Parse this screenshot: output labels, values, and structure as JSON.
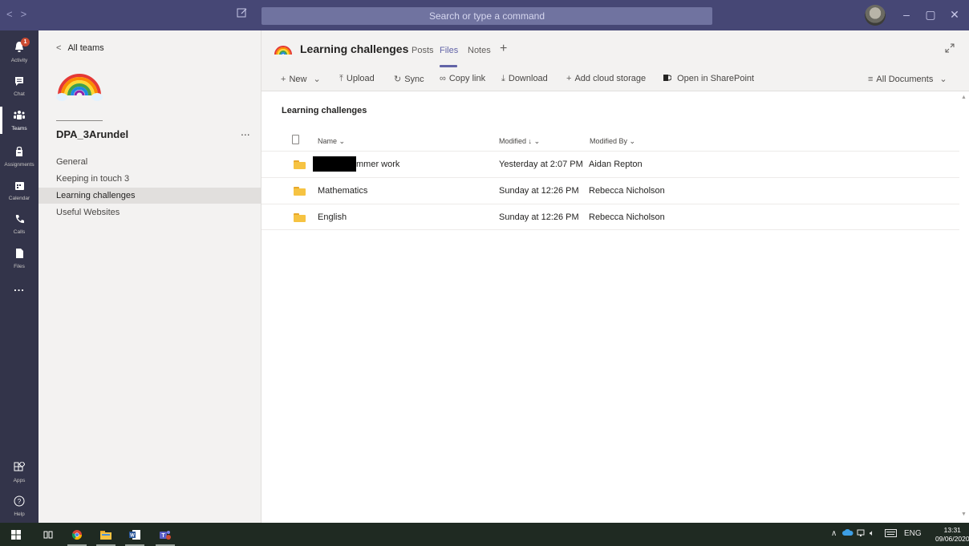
{
  "titlebar": {
    "search_placeholder": "Search or type a command",
    "back_glyph": "<",
    "forward_glyph": ">",
    "minimize_glyph": "–",
    "maximize_glyph": "▢",
    "close_glyph": "✕"
  },
  "rail": {
    "activity": {
      "label": "Activity",
      "badge": "1"
    },
    "chat": {
      "label": "Chat"
    },
    "teams": {
      "label": "Teams"
    },
    "assignments": {
      "label": "Assignments"
    },
    "calendar": {
      "label": "Calendar"
    },
    "calls": {
      "label": "Calls"
    },
    "files": {
      "label": "Files"
    },
    "more": {
      "label": "..."
    },
    "apps": {
      "label": "Apps"
    },
    "help": {
      "label": "Help"
    }
  },
  "teams_panel": {
    "all_teams": "All teams",
    "team_name": "DPA_3Arundel",
    "more_options": "...",
    "channels": [
      {
        "label": "General"
      },
      {
        "label": "Keeping in touch 3"
      },
      {
        "label": "Learning challenges"
      },
      {
        "label": "Useful Websites"
      }
    ]
  },
  "header": {
    "title": "Learning challenges",
    "tabs": [
      {
        "label": "Posts"
      },
      {
        "label": "Files"
      },
      {
        "label": "Notes"
      }
    ],
    "add_tab": "+"
  },
  "toolbar": {
    "new": "New",
    "upload": "Upload",
    "sync": "Sync",
    "copy_link": "Copy link",
    "download": "Download",
    "add_cloud": "Add cloud storage",
    "open_sharepoint": "Open in SharePoint",
    "view": "All Documents"
  },
  "files": {
    "section_title": "Learning challenges",
    "columns": {
      "name": "Name",
      "modified": "Modified",
      "modified_by": "Modified By"
    },
    "rows": [
      {
        "name": "mmer work",
        "modified": "Yesterday at 2:07 PM",
        "modified_by": "Aidan Repton"
      },
      {
        "name": "Mathematics",
        "modified": "Sunday at 12:26 PM",
        "modified_by": "Rebecca Nicholson"
      },
      {
        "name": "English",
        "modified": "Sunday at 12:26 PM",
        "modified_by": "Rebecca Nicholson"
      }
    ]
  },
  "taskbar": {
    "language": "ENG",
    "time": "13:31",
    "date": "09/06/2020"
  },
  "colors": {
    "titlebar": "#464775",
    "rail": "#33344a",
    "accent": "#6264a7",
    "taskbar": "#1f2a22"
  }
}
